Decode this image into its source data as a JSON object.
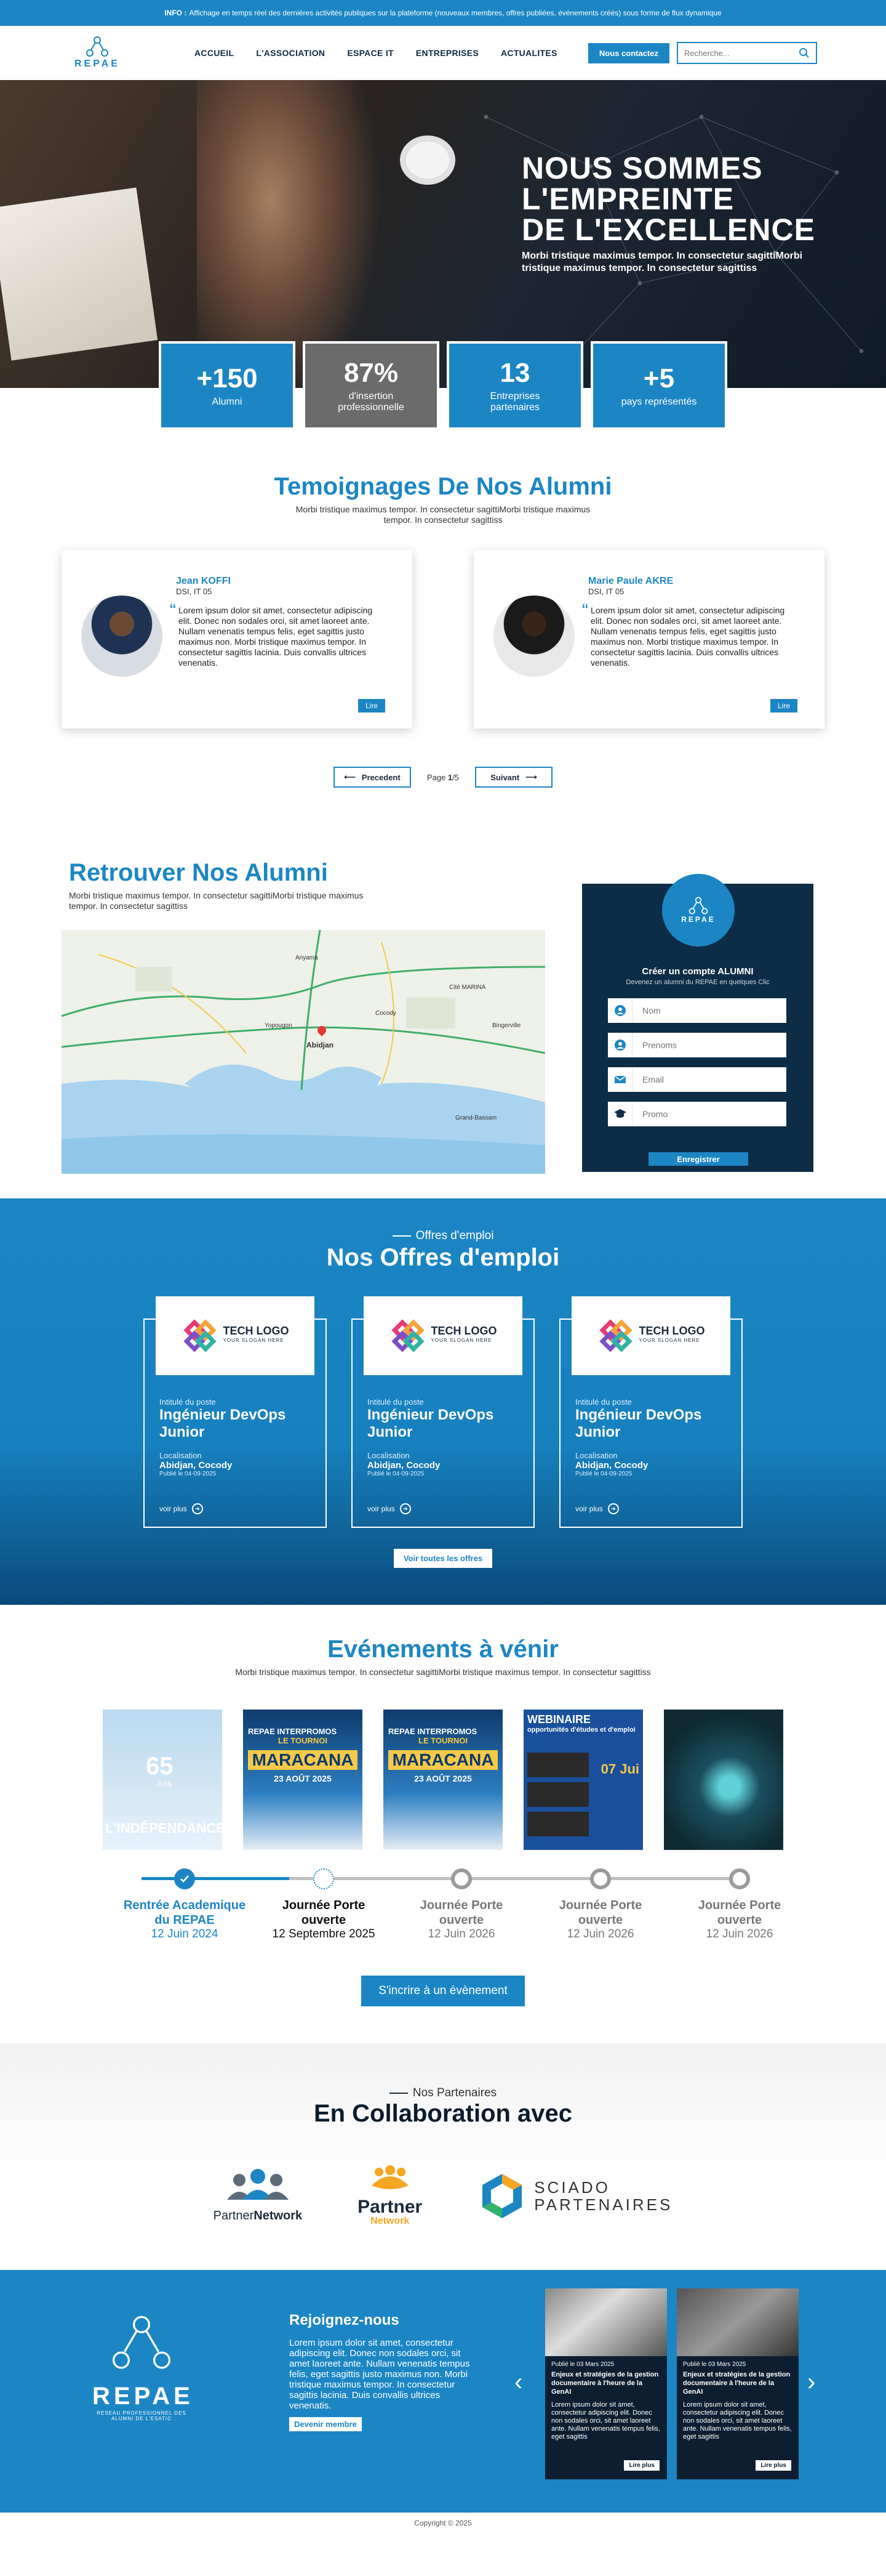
{
  "topbar": {
    "label": "INFO :",
    "text": "Affichage en temps réel des dernières activités publiques sur la plateforme (nouveaux membres, offres publiées, événements créés) sous forme de flux dynamique"
  },
  "header": {
    "logo": "REPAE",
    "nav": [
      "ACCUEIL",
      "L'ASSOCIATION",
      "ESPACE IT",
      "ENTREPRISES",
      "ACTUALITES"
    ],
    "contact": "Nous contactez",
    "search_placeholder": "Recherche..."
  },
  "hero": {
    "title": [
      "NOUS SOMMES",
      "L'EMPREINTE",
      "DE L'EXCELLENCE"
    ],
    "text": "Morbi tristique maximus tempor. In consectetur sagittiMorbi tristique maximus tempor. In consectetur sagittiss"
  },
  "stats": [
    {
      "num": "+150",
      "label": "Alumni"
    },
    {
      "num": "87%",
      "label": "d'insertion professionnelle"
    },
    {
      "num": "13",
      "label": "Entreprises partenaires"
    },
    {
      "num": "+5",
      "label": "pays représentés"
    }
  ],
  "testimonials": {
    "title": "Temoignages De Nos Alumni",
    "subtitle": "Morbi tristique maximus tempor. In consectetur sagittiMorbi tristique maximus tempor. In consectetur sagittiss",
    "items": [
      {
        "name": "Jean KOFFI",
        "role": "DSI, IT 05",
        "text": "Lorem ipsum dolor sit amet, consectetur adipiscing elit. Donec non sodales orci, sit amet laoreet ante. Nullam venenatis tempus felis, eget sagittis justo maximus non. Morbi tristique maximus tempor. In consectetur sagittis lacinia. Duis convallis ultrices venenatis.",
        "btn": "Lire"
      },
      {
        "name": "Marie Paule AKRE",
        "role": "DSI, IT 05",
        "text": "Lorem ipsum dolor sit amet, consectetur adipiscing elit. Donec non sodales orci, sit amet laoreet ante. Nullam venenatis tempus felis, eget sagittis justo maximus non. Morbi tristique maximus tempor. In consectetur sagittis lacinia. Duis convallis ultrices venenatis.",
        "btn": "Lire"
      }
    ],
    "prev": "Precedent",
    "next": "Suivant",
    "page_label": "Page",
    "page_cur": "1",
    "page_total": "/5"
  },
  "alumni": {
    "title": "Retrouver Nos Alumni",
    "subtitle": "Morbi tristique maximus tempor. In consectetur sagittiMorbi tristique maximus tempor. In consectetur sagittiss",
    "map_labels": [
      "Abidjan",
      "Cité MARINA",
      "Bingerville",
      "Anyama",
      "Yopougon",
      "Cocody",
      "Grand-Bassam"
    ],
    "form": {
      "logo": "REPAE",
      "title": "Créer un compte ALUMNI",
      "subtitle": "Devenez un alumni du REPAE en quelques Clic",
      "nom": "Nom",
      "prenom": "Prenoms",
      "email": "Email",
      "promo": "Promo",
      "btn": "Enregistrer"
    }
  },
  "jobs": {
    "kicker": "Offres d'emploi",
    "title": "Nos Offres d'emploi",
    "items": [
      {
        "logo": "TECH LOGO",
        "slogan": "YOUR SLOGAN HERE",
        "k1": "Intitulé du poste",
        "title": "Ingénieur DevOps Junior",
        "k2": "Localisation",
        "loc": "Abidjan, Cocody",
        "date": "Publié le 04-09-2025",
        "more": "voir plus"
      },
      {
        "logo": "TECH LOGO",
        "slogan": "YOUR SLOGAN HERE",
        "k1": "Intitulé du poste",
        "title": "Ingénieur DevOps Junior",
        "k2": "Localisation",
        "loc": "Abidjan, Cocody",
        "date": "Publié le 04-09-2025",
        "more": "voir plus"
      },
      {
        "logo": "TECH LOGO",
        "slogan": "YOUR SLOGAN HERE",
        "k1": "Intitulé du poste",
        "title": "Ingénieur DevOps Junior",
        "k2": "Localisation",
        "loc": "Abidjan, Cocody",
        "date": "Publié le 04-09-2025",
        "more": "voir plus"
      }
    ],
    "all": "Voir toutes les offres"
  },
  "events": {
    "title": "Evénements à vénir",
    "subtitle": "Morbi tristique maximus tempor. In consectetur sagittiMorbi tristique maximus tempor. In consectetur sagittiss",
    "posters": [
      {
        "a": "65",
        "b": "Ans",
        "c": "L'INDÉPENDANCE"
      },
      {
        "a": "REPAE INTERPROMOS",
        "b": "LE TOURNOI",
        "c": "MARACANA",
        "d": "23 AOÛT 2025"
      },
      {
        "a": "REPAE INTERPROMOS",
        "b": "LE TOURNOI",
        "c": "MARACANA",
        "d": "23 AOÛT 2025"
      },
      {
        "a": "WEBINAIRE",
        "b": "opportunités d'études et d'emploi",
        "c": "07 Jui"
      },
      {
        "a": "",
        "b": "",
        "c": ""
      }
    ],
    "timeline": [
      {
        "t": "Rentrée Academique du REPAE",
        "d": "12 Juin 2024"
      },
      {
        "t": "Journée Porte ouverte",
        "d": "12 Septembre 2025"
      },
      {
        "t": "Journée Porte ouverte",
        "d": "12 Juin 2026"
      },
      {
        "t": "Journée Porte ouverte",
        "d": "12 Juin 2026"
      },
      {
        "t": "Journée Porte ouverte",
        "d": "12 Juin 2026"
      }
    ],
    "btn": "S'incrire à un évènement"
  },
  "partners": {
    "kicker": "Nos Partenaires",
    "title": "En Collaboration avec",
    "logos": [
      {
        "a": "Partner",
        "b": "Network"
      },
      {
        "a": "Partner",
        "b": "Network"
      },
      {
        "a": "SCIADO",
        "b": "PARTENAIRES"
      }
    ]
  },
  "footer": {
    "logo": "REPAE",
    "logo_sub": "RESEAU PROFESSIONNEL DES ALUMNI DE L'ESATIC",
    "join_title": "Rejoignez-nous",
    "join_text": "Lorem ipsum dolor sit amet, consectetur adipiscing elit. Donec non sodales orci, sit amet laoreet ante. Nullam venenatis tempus felis, eget sagittis justo maximus non. Morbi tristique maximus tempor. In consectetur sagittis lacinia. Duis convallis ultrices venenatis.",
    "member": "Devenir membre",
    "news": [
      {
        "date": "Publié le 03 Mars 2025",
        "title": "Enjeux et stratégies de la gestion documentaire à l'heure de la GenAI",
        "text": "Lorem ipsum dolor sit amet, consectetur adipiscing elit. Donec non sodales orci, sit amet laoreet ante. Nullam venenatis tempus felis, eget sagittis",
        "btn": "Lire plus"
      },
      {
        "date": "Publié le 03 Mars 2025",
        "title": "Enjeux et stratégies de la gestion documentaire à l'heure de la GenAI",
        "text": "Lorem ipsum dolor sit amet, consectetur adipiscing elit. Donec non sodales orci, sit amet laoreet ante. Nullam venenatis tempus felis, eget sagittis",
        "btn": "Lire plus"
      }
    ],
    "copyright": "Copyright © 2025"
  },
  "colors": {
    "primary": "#1c86c4",
    "dark": "#0d2d47",
    "gray": "#6b6b6b"
  }
}
